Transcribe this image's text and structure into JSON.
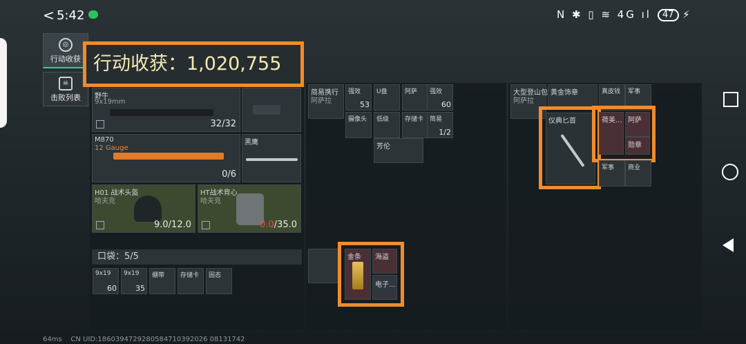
{
  "status_bar": {
    "time": "5:42",
    "battery": "47",
    "icons": "N ✱ ▯ ≋ 4G ıl"
  },
  "tabs": [
    {
      "label": "行动收获"
    },
    {
      "label": "击败列表"
    }
  ],
  "harvest_banner": {
    "label": "行动收获：",
    "value": "1,020,755"
  },
  "weapons": [
    {
      "name": "野牛",
      "caliber": "9x19mm",
      "ammo": "32/32"
    },
    {
      "name": "M870",
      "caliber": "12 Gauge",
      "ammo": "0/6"
    },
    {
      "name": "黑鹰"
    }
  ],
  "armor": [
    {
      "name": "H01 战术头盔",
      "maker": "哈夫克",
      "durability": "9.0/12.0"
    },
    {
      "name": "HT战术背心",
      "maker": "哈夫克",
      "durability_current": "0.0",
      "durability_max": "/35.0"
    }
  ],
  "pocket": {
    "label": "口袋：",
    "count": "5/5",
    "items": [
      {
        "name": "9x19",
        "count": "60"
      },
      {
        "name": "9x19",
        "count": "35"
      },
      {
        "name": "绷带"
      },
      {
        "name": "存储卡"
      },
      {
        "name": "固态"
      }
    ]
  },
  "middle_items": [
    {
      "name": "简易携行",
      "sub": "阿萨拉"
    },
    {
      "name": "强效",
      "count": "53"
    },
    {
      "name": "U盘"
    },
    {
      "name": "阿萨"
    },
    {
      "name": "强效",
      "count": "60"
    },
    {
      "name": "摄像头"
    },
    {
      "name": "低级"
    },
    {
      "name": "存储卡"
    },
    {
      "name": "简易",
      "count": "1/2"
    },
    {
      "name": "芳伦"
    }
  ],
  "pouch_items": [
    {
      "name": "金条"
    },
    {
      "name": "海盗"
    },
    {
      "name": "电子..."
    }
  ],
  "right_items": [
    {
      "name": "大型登山包",
      "sub": "阿萨拉"
    },
    {
      "name": "黄金饰章"
    },
    {
      "name": "真皮钱"
    },
    {
      "name": "军事"
    },
    {
      "name": "仪典匕首"
    },
    {
      "name": "荷美..."
    },
    {
      "name": "阿萨"
    },
    {
      "name": "勋章"
    },
    {
      "name": "军事"
    },
    {
      "name": "商业"
    }
  ],
  "footer": {
    "ping": "64ms",
    "uid": "CN UID:1860394729280584710392026 08131742"
  }
}
